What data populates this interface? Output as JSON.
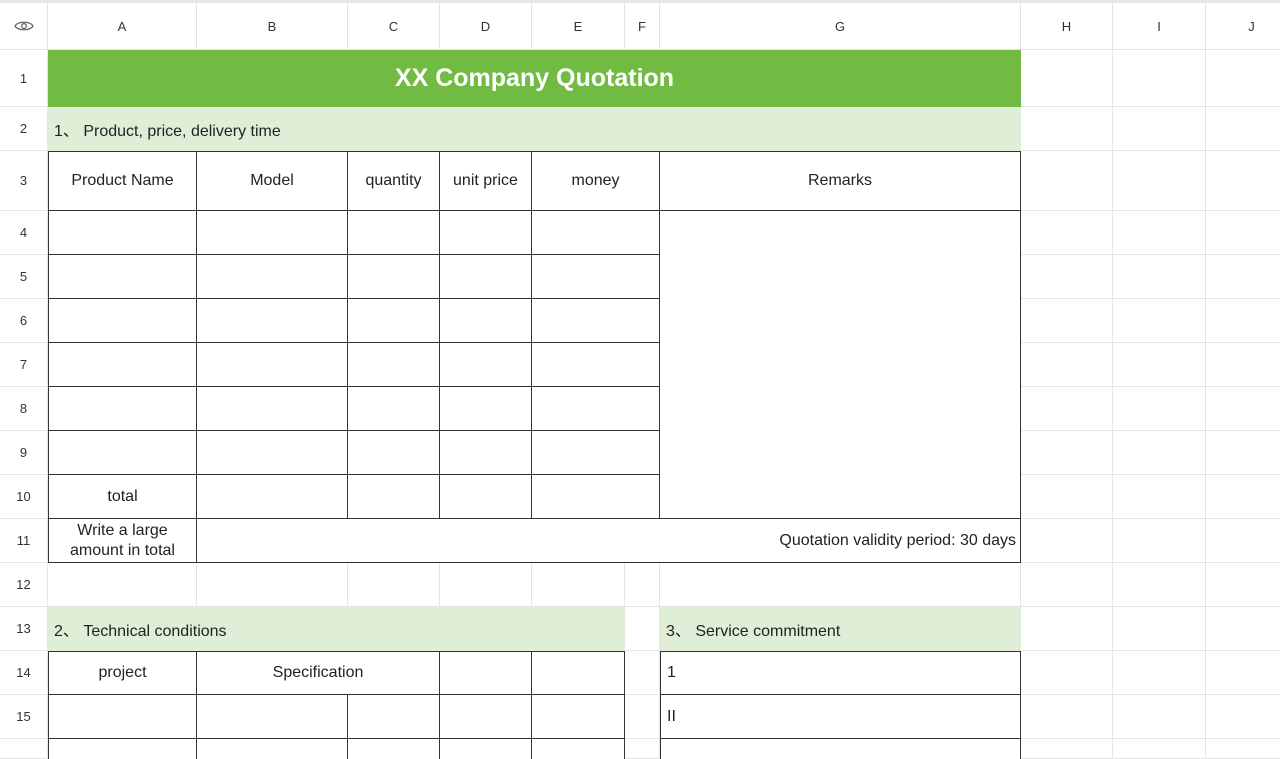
{
  "columns": [
    "A",
    "B",
    "C",
    "D",
    "E",
    "F",
    "G",
    "H",
    "I",
    "J"
  ],
  "rows": [
    "1",
    "2",
    "3",
    "4",
    "5",
    "6",
    "7",
    "8",
    "9",
    "10",
    "11",
    "12",
    "13",
    "14",
    "15"
  ],
  "title": "XX Company Quotation",
  "section1": "1、 Product, price, delivery time",
  "headers": {
    "product_name": "Product Name",
    "model": "Model",
    "quantity": "quantity",
    "unit_price": "unit price",
    "money": "money",
    "remarks": "Remarks"
  },
  "total_label": "total",
  "large_amount_label": "Write a large amount in total",
  "validity": "Quotation validity period: 30 days",
  "section2": "2、 Technical conditions",
  "section3": "3、 Service commitment",
  "tech_headers": {
    "project": "project",
    "specification": "Specification"
  },
  "service_items": [
    "1",
    "II"
  ],
  "colors": {
    "title_bg": "#72bb43",
    "section_bg": "#e0eed7"
  },
  "icons": {
    "corner": "eye-icon"
  }
}
